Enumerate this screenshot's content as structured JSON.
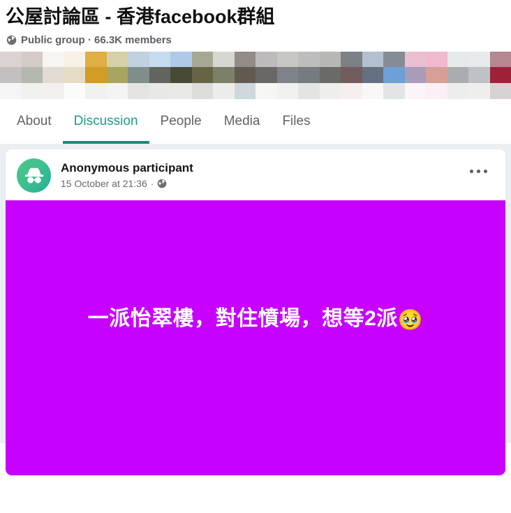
{
  "group": {
    "title": "公屋討論區 - 香港facebook群組",
    "privacy_icon": "globe-icon",
    "privacy": "Public group",
    "separator": "·",
    "members": "66.3K members",
    "meta_line": "Public group · 66.3K members"
  },
  "cover": {
    "description": "pixelated-cover-photo",
    "rows": [
      [
        "#dbd3d1",
        "#d4cbc9",
        "#f7f5f1",
        "#f7f1e6",
        "#e0ae44",
        "#d5d0a8",
        "#c2d1df",
        "#c6dcee",
        "#aecae7",
        "#a7a894",
        "#d6d6d2",
        "#938b88",
        "#bdbcba",
        "#c9c7c4",
        "#bdbdbb",
        "#b7b7b5",
        "#7d8085",
        "#b4c0cd",
        "#868c96",
        "#e9bfd1",
        "#f0b9cf",
        "#e7eaec",
        "#e8ebed",
        "#b58790"
      ],
      [
        "#c2c0c0",
        "#b4b8ae",
        "#e1dbd2",
        "#e4dcc5",
        "#d39c22",
        "#a9a460",
        "#7f8d8b",
        "#61655d",
        "#464a35",
        "#666346",
        "#7d8068",
        "#635a4f",
        "#6a6866",
        "#7e838a",
        "#767b80",
        "#6a6a69",
        "#735c5c",
        "#657083",
        "#6e9fd6",
        "#a99cba",
        "#d79f95",
        "#aaacb0",
        "#bec1c5",
        "#9e2139"
      ],
      [
        "#f4f5f4",
        "#f0f0ee",
        "#f2f0ee",
        "#fbfbfa",
        "#f1f1ef",
        "#f4f4f2",
        "#e4e4e2",
        "#e8e8e6",
        "#e9e9e7",
        "#dcdcda",
        "#ececea",
        "#cdd7dc",
        "#f6f6f5",
        "#f1f1ef",
        "#e4e4e2",
        "#eeeeec",
        "#f6efee",
        "#f9f8f7",
        "#e2e5e6",
        "#fbf4f8",
        "#fbf0f5",
        "#ededeb",
        "#eeeeec",
        "#d6d3d2"
      ]
    ]
  },
  "tabs": [
    {
      "id": "about",
      "label": "About",
      "active": false
    },
    {
      "id": "discussion",
      "label": "Discussion",
      "active": true
    },
    {
      "id": "people",
      "label": "People",
      "active": false
    },
    {
      "id": "media",
      "label": "Media",
      "active": false
    },
    {
      "id": "files",
      "label": "Files",
      "active": false
    }
  ],
  "colors": {
    "accent_teal": "#1a9c88",
    "accent_underline": "#1a8d7c",
    "post_image_bg": "#c700ff",
    "page_bg": "#eceff2",
    "text_primary": "#131619",
    "text_secondary": "#65686c"
  },
  "post": {
    "avatar_icon": "incognito-avatar-icon",
    "author": "Anonymous participant",
    "timestamp": "15 October at 21:36",
    "separator": "·",
    "audience_icon": "globe-icon",
    "menu_label": "•••",
    "image": {
      "background_color": "#c700ff",
      "text": "一派怡翠樓，對住憤場，想等2派",
      "emoji": "🥹"
    }
  }
}
